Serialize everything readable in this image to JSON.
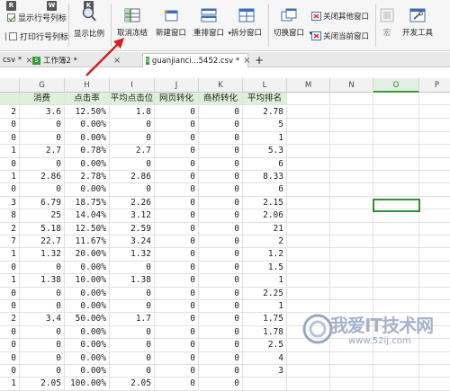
{
  "ribbon": {
    "show_rowcol_label": "显示行号列标",
    "print_rowcol_label": "打印行号列标",
    "show_ratio_label": "显示比例",
    "unfreeze_label": "取消冻结",
    "new_window_label": "新建窗口",
    "rearrange_label": "重排窗口",
    "split_label": "拆分窗口",
    "switch_window_label": "切换窗口",
    "close_others_label": "关闭其他窗口",
    "close_current_label": "关闭当前窗口",
    "macro_label": "宏",
    "dev_tools_label": "开发工具",
    "keytip_r": "R",
    "keytip_w": "W",
    "keytip_k": "K"
  },
  "tabs": [
    {
      "label": "csv *"
    },
    {
      "label": "工作簿2 *"
    },
    {
      "label": "guanjianci...5452.csv *"
    },
    {
      "label": "+"
    }
  ],
  "columns": [
    "G",
    "H",
    "I",
    "J",
    "K",
    "L",
    "M",
    "N",
    "O",
    "P"
  ],
  "selected_column": "O",
  "header_row": [
    "消费",
    "点击率",
    "平均点击位",
    "网页转化",
    "商桥转化",
    "平均排名"
  ],
  "rows": [
    {
      "a": "2",
      "g": "3.6",
      "h": "12.50%",
      "i": "1.8",
      "j": "0",
      "k": "0",
      "l": "2.78"
    },
    {
      "a": "0",
      "g": "0",
      "h": "0.00%",
      "i": "0",
      "j": "0",
      "k": "0",
      "l": "5"
    },
    {
      "a": "0",
      "g": "0",
      "h": "0.00%",
      "i": "0",
      "j": "0",
      "k": "0",
      "l": "1"
    },
    {
      "a": "1",
      "g": "2.7",
      "h": "0.78%",
      "i": "2.7",
      "j": "0",
      "k": "0",
      "l": "5.3"
    },
    {
      "a": "0",
      "g": "0",
      "h": "0.00%",
      "i": "0",
      "j": "0",
      "k": "0",
      "l": "6"
    },
    {
      "a": "1",
      "g": "2.86",
      "h": "2.78%",
      "i": "2.86",
      "j": "0",
      "k": "0",
      "l": "8.33"
    },
    {
      "a": "0",
      "g": "0",
      "h": "0.00%",
      "i": "0",
      "j": "0",
      "k": "0",
      "l": "6"
    },
    {
      "a": "3",
      "g": "6.79",
      "h": "18.75%",
      "i": "2.26",
      "j": "0",
      "k": "0",
      "l": "2.15"
    },
    {
      "a": "8",
      "g": "25",
      "h": "14.04%",
      "i": "3.12",
      "j": "0",
      "k": "0",
      "l": "2.06"
    },
    {
      "a": "2",
      "g": "5.18",
      "h": "12.50%",
      "i": "2.59",
      "j": "0",
      "k": "0",
      "l": "21"
    },
    {
      "a": "7",
      "g": "22.7",
      "h": "11.67%",
      "i": "3.24",
      "j": "0",
      "k": "0",
      "l": "2"
    },
    {
      "a": "1",
      "g": "1.32",
      "h": "20.00%",
      "i": "1.32",
      "j": "0",
      "k": "0",
      "l": "1.2"
    },
    {
      "a": "0",
      "g": "0",
      "h": "0.00%",
      "i": "0",
      "j": "0",
      "k": "0",
      "l": "1.5"
    },
    {
      "a": "1",
      "g": "1.38",
      "h": "10.00%",
      "i": "1.38",
      "j": "0",
      "k": "0",
      "l": "1"
    },
    {
      "a": "0",
      "g": "0",
      "h": "0.00%",
      "i": "0",
      "j": "0",
      "k": "0",
      "l": "2.25"
    },
    {
      "a": "0",
      "g": "0",
      "h": "0.00%",
      "i": "0",
      "j": "0",
      "k": "0",
      "l": "1"
    },
    {
      "a": "2",
      "g": "3.4",
      "h": "50.00%",
      "i": "1.7",
      "j": "0",
      "k": "0",
      "l": "1.75"
    },
    {
      "a": "0",
      "g": "0",
      "h": "0.00%",
      "i": "0",
      "j": "0",
      "k": "0",
      "l": "1.78"
    },
    {
      "a": "0",
      "g": "0",
      "h": "0.00%",
      "i": "0",
      "j": "0",
      "k": "0",
      "l": "2.5"
    },
    {
      "a": "0",
      "g": "0",
      "h": "0.00%",
      "i": "0",
      "j": "0",
      "k": "0",
      "l": "4"
    },
    {
      "a": "0",
      "g": "0",
      "h": "0.00%",
      "i": "0",
      "j": "0",
      "k": "0",
      "l": "3"
    },
    {
      "a": "1",
      "g": "2.05",
      "h": "100.00%",
      "i": "2.05",
      "j": "0",
      "k": "0",
      "l": ""
    }
  ],
  "watermark": {
    "title": "我爱IT技术网",
    "url": "www.52ij.com"
  },
  "colors": {
    "accent_green": "#2f8f2f",
    "header_fill": "#dff0d8",
    "arrow_red": "#d42020"
  }
}
